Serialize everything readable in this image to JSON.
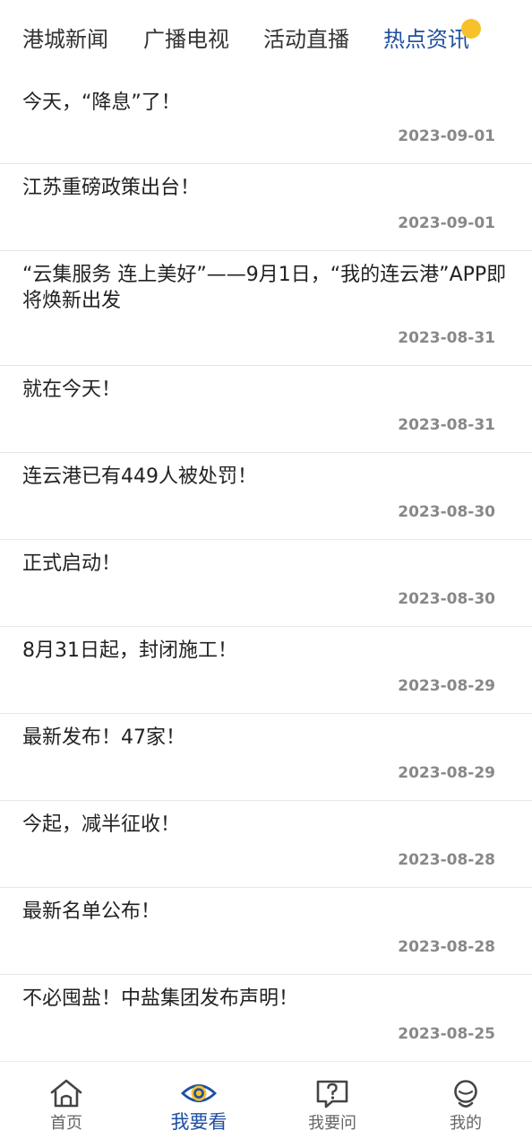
{
  "tabs": [
    {
      "label": "港城新闻"
    },
    {
      "label": "广播电视"
    },
    {
      "label": "活动直播"
    },
    {
      "label": "热点资讯"
    }
  ],
  "news": [
    {
      "title": "今天，“降息”了！",
      "date": "2023-09-01"
    },
    {
      "title": "江苏重磅政策出台！",
      "date": "2023-09-01"
    },
    {
      "title": "“云集服务 连上美好”——9月1日，“我的连云港”APP即将焕新出发",
      "date": "2023-08-31"
    },
    {
      "title": "就在今天！",
      "date": "2023-08-31"
    },
    {
      "title": "连云港已有449人被处罚！",
      "date": "2023-08-30"
    },
    {
      "title": "正式启动！",
      "date": "2023-08-30"
    },
    {
      "title": "8月31日起，封闭施工！",
      "date": "2023-08-29"
    },
    {
      "title": "最新发布！47家！",
      "date": "2023-08-29"
    },
    {
      "title": "今起，减半征收！",
      "date": "2023-08-28"
    },
    {
      "title": "最新名单公布！",
      "date": "2023-08-28"
    },
    {
      "title": "不必囤盐！中盐集团发布声明！",
      "date": "2023-08-25"
    }
  ],
  "bottom_nav": [
    {
      "label": "首页",
      "icon": "home-icon"
    },
    {
      "label": "我要看",
      "icon": "eye-icon"
    },
    {
      "label": "我要问",
      "icon": "question-bubble-icon"
    },
    {
      "label": "我的",
      "icon": "profile-icon"
    }
  ],
  "colors": {
    "accent": "#1f4fa0",
    "badge": "#f6c12b",
    "date": "#888888"
  }
}
